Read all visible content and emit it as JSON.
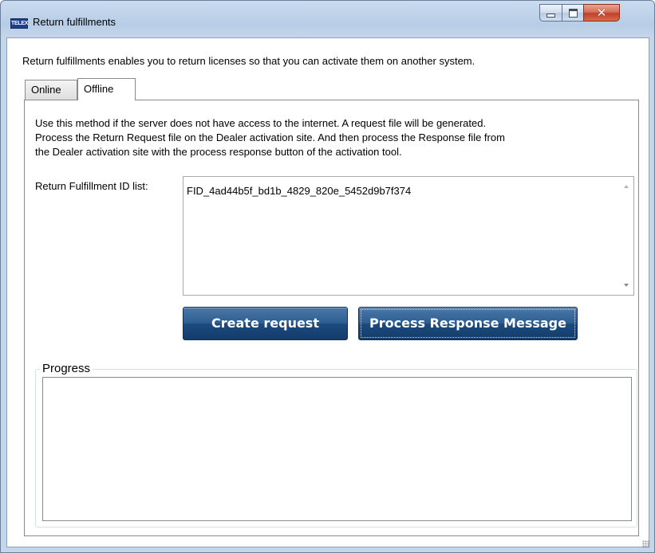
{
  "window": {
    "title": "Return fulfillments",
    "app_icon_text": "TELEX"
  },
  "intro_text": "Return fulfillments enables you to return licenses so that you can activate them on another system.",
  "tabs": [
    {
      "label": "Online",
      "selected": false
    },
    {
      "label": "Offline",
      "selected": true
    }
  ],
  "offline": {
    "description_lines": [
      "Use this method if the server does not have access to the internet. A request file will be generated.",
      "Process the Return Request file on the Dealer activation site. And then process the Response file from",
      "the Dealer activation site with the process response button of the activation tool."
    ],
    "id_list_label": "Return Fulfillment ID list:",
    "id_list_value": "FID_4ad44b5f_bd1b_4829_820e_5452d9b7f374",
    "create_request_label": "Create request",
    "process_response_label": "Process Response Message",
    "progress_label": "Progress",
    "progress_text": ""
  },
  "colors": {
    "button_blue": "#1c4a7d",
    "window_frame": "#c4d6ea",
    "close_red": "#c0402a"
  }
}
